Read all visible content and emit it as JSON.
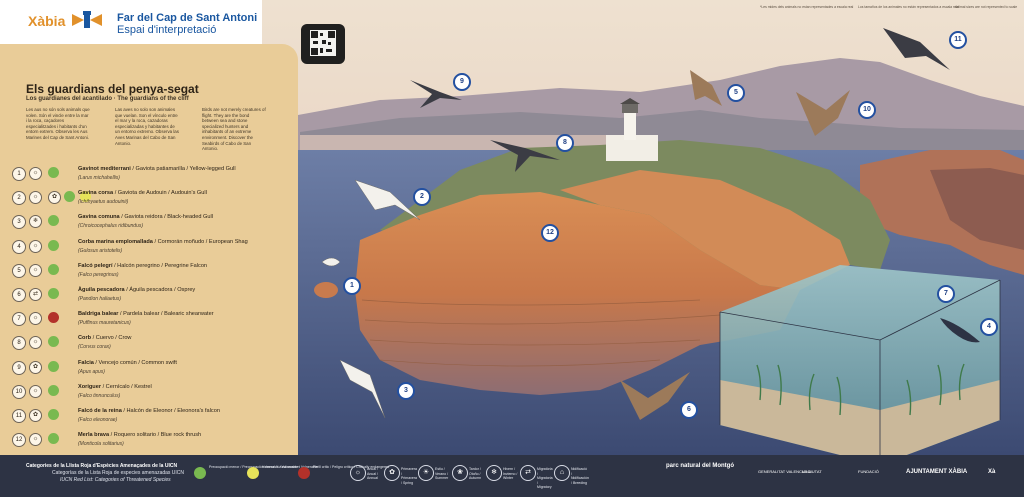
{
  "header": {
    "brand": "Xàbia",
    "title_line1": "Far del Cap de Sant Antoni",
    "title_line2": "Espai d'interpretació"
  },
  "top_notes": [
    "*Les mides dels animals no estan representades a escala real",
    "Los tamaños de los animales no están representados a escala real",
    "Animal sizes are not represented to scale"
  ],
  "panel": {
    "heading": "Els guardians del penya-segat",
    "subheading": "Los guardianes del acantilado · The guardians of the cliff",
    "intro_ca": "Les aus no són sols animals que volen. Són el vincle entre la mar i la roca, caçadores especialitzades i habitants d'un entorn extrem. Observa les Aus Marines del Cap de Sant Antoni.",
    "intro_es": "Las aves no solo son animales que vuelan. Son el vínculo entre el mar y la roca, cazadoras especializadas y habitantes de un entorno extremo. Observa las Aves Marinas del Cabo de San Antonio.",
    "intro_en": "Birds are not merely creatures of flight. They are the bond between sea and stone specialized hunters and inhabitants of an extreme environment. Discover the Seabirds of Cabo de San Antonio."
  },
  "species": [
    {
      "num": "1",
      "name_ca": "Gavinot mediterrani",
      "rest": " / Gaviota patiamarilla / Yellow-legged Gull",
      "sci": "(Larus michahellis)",
      "icons": [
        "☼"
      ],
      "status_colors": [
        "#79b950"
      ]
    },
    {
      "num": "2",
      "name_ca": "Gavina corsa",
      "rest": " / Gaviota de Audouin / Audouin's Gull",
      "sci": "(Ichthyaetus audouinii)",
      "icons": [
        "☼",
        "✿"
      ],
      "status_colors": [
        "#79b950",
        "#e6e35a"
      ]
    },
    {
      "num": "3",
      "name_ca": "Gavina comuna",
      "rest": " / Gaviota reidora / Black-headed Gull",
      "sci": "(Chroicocephalus ridibundus)",
      "icons": [
        "❄"
      ],
      "status_colors": [
        "#79b950"
      ]
    },
    {
      "num": "4",
      "name_ca": "Corba marina emplomallada",
      "rest": " / Cormorán moñudo / European Shag",
      "sci": "(Gulosus aristotelis)",
      "icons": [
        "☼"
      ],
      "status_colors": [
        "#79b950"
      ]
    },
    {
      "num": "5",
      "name_ca": "Falcó pelegrí",
      "rest": " / Halcón peregrino / Peregrine Falcon",
      "sci": "(Falco peregrinus)",
      "icons": [
        "☼"
      ],
      "status_colors": [
        "#79b950"
      ]
    },
    {
      "num": "6",
      "name_ca": "Àguila pescadora",
      "rest": " / Águila pescadora / Osprey",
      "sci": "(Pandion haliaetus)",
      "icons": [
        "⇄"
      ],
      "status_colors": [
        "#79b950"
      ]
    },
    {
      "num": "7",
      "name_ca": "Baldriga balear",
      "rest": " / Pardela balear / Balearic shearwater",
      "sci": "(Puffinus mauretanicus)",
      "icons": [
        "☼"
      ],
      "status_colors": [
        "#b3312a"
      ]
    },
    {
      "num": "8",
      "name_ca": "Corb",
      "rest": " / Cuervo / Crow",
      "sci": "(Corvus corax)",
      "icons": [
        "☼"
      ],
      "status_colors": [
        "#79b950"
      ]
    },
    {
      "num": "9",
      "name_ca": "Falcia",
      "rest": " / Vencejo común / Common swift",
      "sci": "(Apus apus)",
      "icons": [
        "✿"
      ],
      "status_colors": [
        "#79b950"
      ]
    },
    {
      "num": "10",
      "name_ca": "Xoriguer",
      "rest": " / Cernícalo / Kestrel",
      "sci": "(Falco tinnunculus)",
      "icons": [
        "☼"
      ],
      "status_colors": [
        "#79b950"
      ]
    },
    {
      "num": "11",
      "name_ca": "Falcó de la reina",
      "rest": " / Halcón de Eleonor / Eleonora's falcon",
      "sci": "(Falco eleonorae)",
      "icons": [
        "✿"
      ],
      "status_colors": [
        "#79b950"
      ]
    },
    {
      "num": "12",
      "name_ca": "Merla brava",
      "rest": " / Roquero solitario / Blue rock thrush",
      "sci": "(Monticola solitarius)",
      "icons": [
        "☼"
      ],
      "status_colors": [
        "#79b950"
      ]
    }
  ],
  "footer": {
    "title1": "Categories de la Llista Roja d'Espècies Amenaçades de la UICN",
    "title2": "Categorías de la Lista Roja de especies amenazadas UICN",
    "title3": "IUCN Red List: Categories of Threatened Species",
    "categories": [
      {
        "code": "LC",
        "color": "#79b950",
        "label": "Preocupació menor / Preocupación menor / Least concern"
      },
      {
        "code": "VU",
        "color": "#e6e35a",
        "label": "Vulnerable / Vulnerable / Vulnerable"
      },
      {
        "code": "CR",
        "color": "#b3312a",
        "label": "Perill crític / Peligro crítico / Critically endangered"
      }
    ],
    "seasons": [
      {
        "glyph": "☼",
        "label": "Anual / Anual / Annual"
      },
      {
        "glyph": "✿",
        "label": "Primavera / Primavera / Spring"
      },
      {
        "glyph": "☀",
        "label": "Estiu / Verano / Summer"
      },
      {
        "glyph": "❀",
        "label": "Tardor / Otoño / Autumn"
      },
      {
        "glyph": "❄",
        "label": "Hivern / Invierno / Winter"
      },
      {
        "glyph": "⇄",
        "label": "Migratòria / Migratoria / Migratory"
      },
      {
        "glyph": "⌂",
        "label": "Nidificació / Nidificación / Breeding"
      }
    ],
    "logos": [
      "parc natural del Montgó",
      "GENERALITAT VALENCIANA",
      "LA CIUTAT",
      "FUNDACIÓ",
      "AJUNTAMENT XÀBIA",
      "Xà"
    ]
  },
  "markers": [
    "1",
    "2",
    "3",
    "4",
    "5",
    "6",
    "7",
    "8",
    "9",
    "10",
    "11",
    "12"
  ],
  "colors": {
    "panel": "#e9cc98",
    "footer": "#2d3344",
    "brand_orange": "#e1912b",
    "title_blue": "#1a57a0",
    "marker_blue": "#2350a0"
  }
}
